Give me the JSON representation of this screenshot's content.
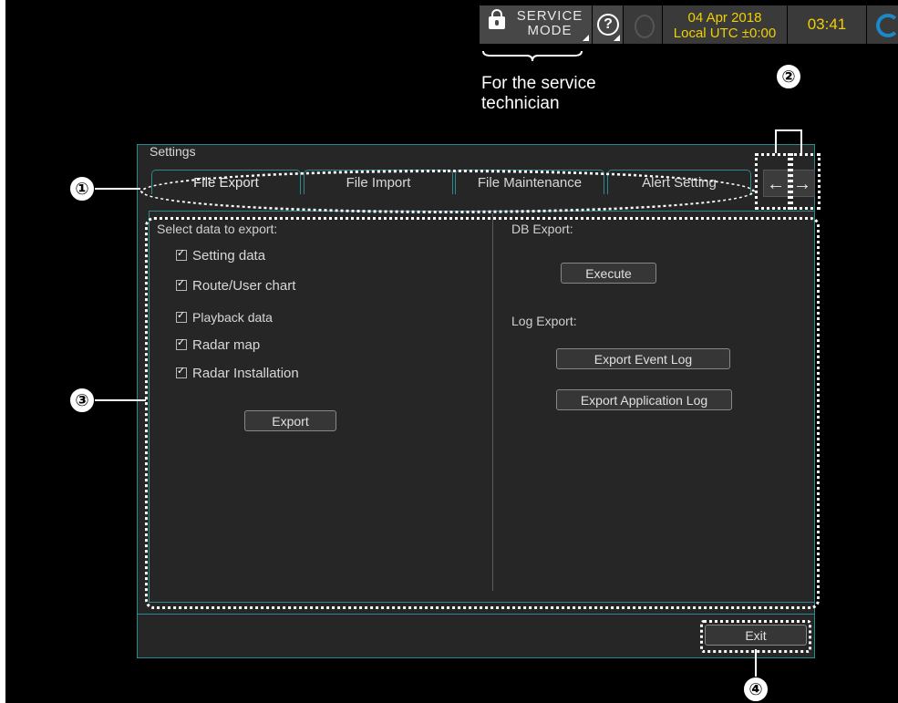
{
  "statusbar": {
    "service_mode_line1": "SERVICE",
    "service_mode_line2": "MODE",
    "help_glyph": "?",
    "date": "04 Apr 2018",
    "utc": "Local UTC ±0:00",
    "time": "03:41"
  },
  "annotation": {
    "service_note_line1": "For the service",
    "service_note_line2": "technician",
    "callouts": [
      "①",
      "②",
      "③",
      "④"
    ]
  },
  "settings": {
    "title": "Settings",
    "tabs": [
      "File Export",
      "File Import",
      "File Maintenance",
      "Alert Setting"
    ],
    "left_arrow": "←",
    "right_arrow": "→",
    "select_label": "Select data to export:",
    "checkboxes": [
      "Setting data",
      "Route/User chart",
      "Playback data",
      "Radar map",
      "Radar Installation"
    ],
    "export_button": "Export",
    "db_export_label": "DB Export:",
    "execute_button": "Execute",
    "log_export_label": "Log Export:",
    "export_event_log_button": "Export Event Log",
    "export_app_log_button": "Export Application Log",
    "exit_button": "Exit"
  },
  "colors": {
    "background": "#000000",
    "panel": "#262626",
    "border": "#2c8a8e",
    "status_text": "#f0d000"
  }
}
